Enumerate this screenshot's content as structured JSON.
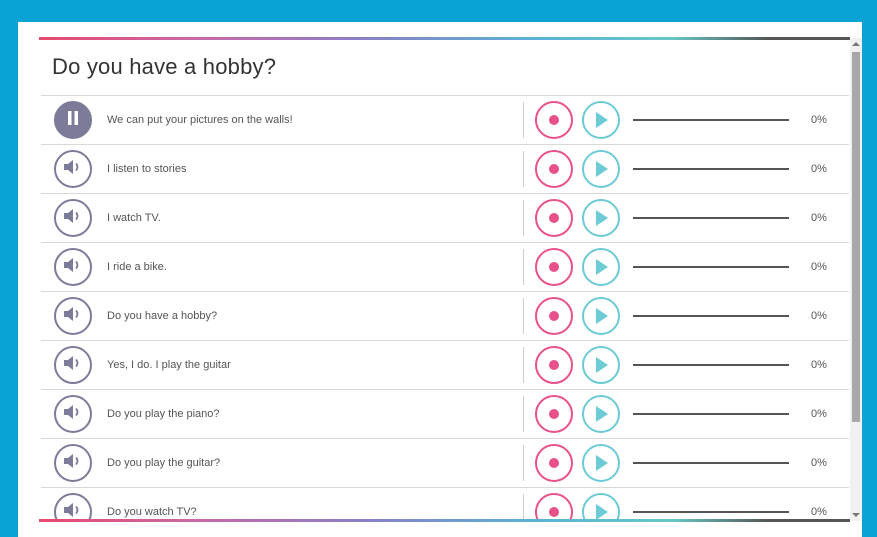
{
  "activity": {
    "title": "Do you have a hobby?"
  },
  "colors": {
    "background": "#0aa3d6",
    "speaker": "#7c7c9a",
    "record": "#e8518a",
    "play": "#6ccbd5"
  },
  "rows": [
    {
      "text": "We can put your pictures on the walls!",
      "progress": 0,
      "progress_label": "0%",
      "state": "playing",
      "speaker_icon": "pause-icon"
    },
    {
      "text": "I listen to stories",
      "progress": 0,
      "progress_label": "0%",
      "state": "idle",
      "speaker_icon": "speaker-icon"
    },
    {
      "text": "I watch TV.",
      "progress": 0,
      "progress_label": "0%",
      "state": "idle",
      "speaker_icon": "speaker-icon"
    },
    {
      "text": "I ride a bike.",
      "progress": 0,
      "progress_label": "0%",
      "state": "idle",
      "speaker_icon": "speaker-icon"
    },
    {
      "text": "Do you have a hobby?",
      "progress": 0,
      "progress_label": "0%",
      "state": "idle",
      "speaker_icon": "speaker-icon"
    },
    {
      "text": "Yes, I do. I play the guitar",
      "progress": 0,
      "progress_label": "0%",
      "state": "idle",
      "speaker_icon": "speaker-icon"
    },
    {
      "text": "Do you play the piano?",
      "progress": 0,
      "progress_label": "0%",
      "state": "idle",
      "speaker_icon": "speaker-icon"
    },
    {
      "text": "Do you play the guitar?",
      "progress": 0,
      "progress_label": "0%",
      "state": "idle",
      "speaker_icon": "speaker-icon"
    },
    {
      "text": "Do you watch TV?",
      "progress": 0,
      "progress_label": "0%",
      "state": "idle",
      "speaker_icon": "speaker-icon"
    }
  ]
}
